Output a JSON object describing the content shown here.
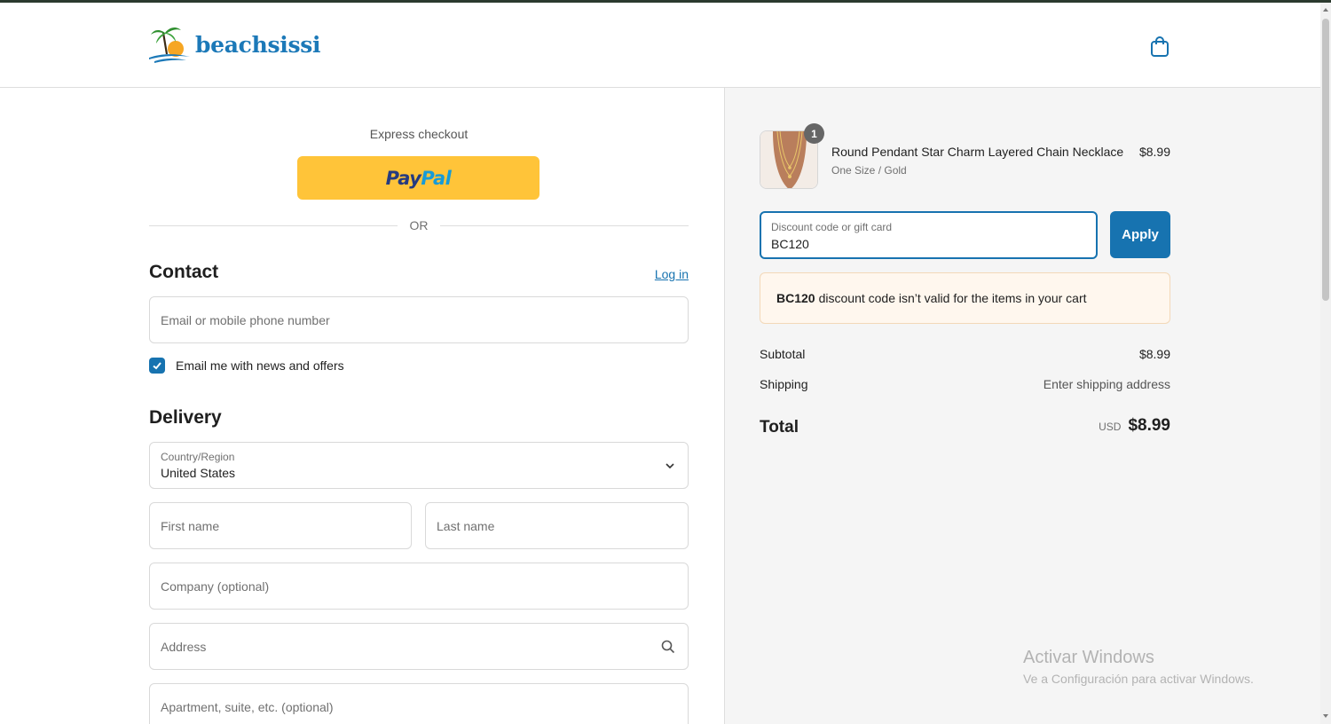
{
  "brand": {
    "name": "beachsissi"
  },
  "express": {
    "label": "Express checkout",
    "paypal_pay": "Pay",
    "paypal_pal": "Pal"
  },
  "divider": {
    "or": "OR"
  },
  "contact": {
    "title": "Contact",
    "login_link": "Log in",
    "email_placeholder": "Email or mobile phone number",
    "newsletter_label": "Email me with news and offers",
    "newsletter_checked": true
  },
  "delivery": {
    "title": "Delivery",
    "country_label": "Country/Region",
    "country_value": "United States",
    "first_name_placeholder": "First name",
    "last_name_placeholder": "Last name",
    "company_placeholder": "Company (optional)",
    "address_placeholder": "Address",
    "apartment_placeholder": "Apartment, suite, etc. (optional)"
  },
  "cart": {
    "item": {
      "quantity": "1",
      "title": "Round Pendant Star Charm Layered Chain Necklace",
      "variant": "One Size / Gold",
      "price": "$8.99"
    },
    "discount": {
      "label": "Discount code or gift card",
      "value": "BC120",
      "apply_label": "Apply"
    },
    "notice": {
      "code": "BC120",
      "message": "discount code isn’t valid for the items in your cart"
    },
    "subtotal_label": "Subtotal",
    "subtotal_value": "$8.99",
    "shipping_label": "Shipping",
    "shipping_value": "Enter shipping address",
    "total_label": "Total",
    "currency": "USD",
    "total_value": "$8.99"
  },
  "watermark": {
    "title": "Activar Windows",
    "subtitle": "Ve a Configuración para activar Windows."
  },
  "colors": {
    "accent": "#1773b0",
    "paypal_yellow": "#ffc439",
    "notice_bg": "#fff7ee",
    "summary_bg": "#f5f5f5"
  }
}
